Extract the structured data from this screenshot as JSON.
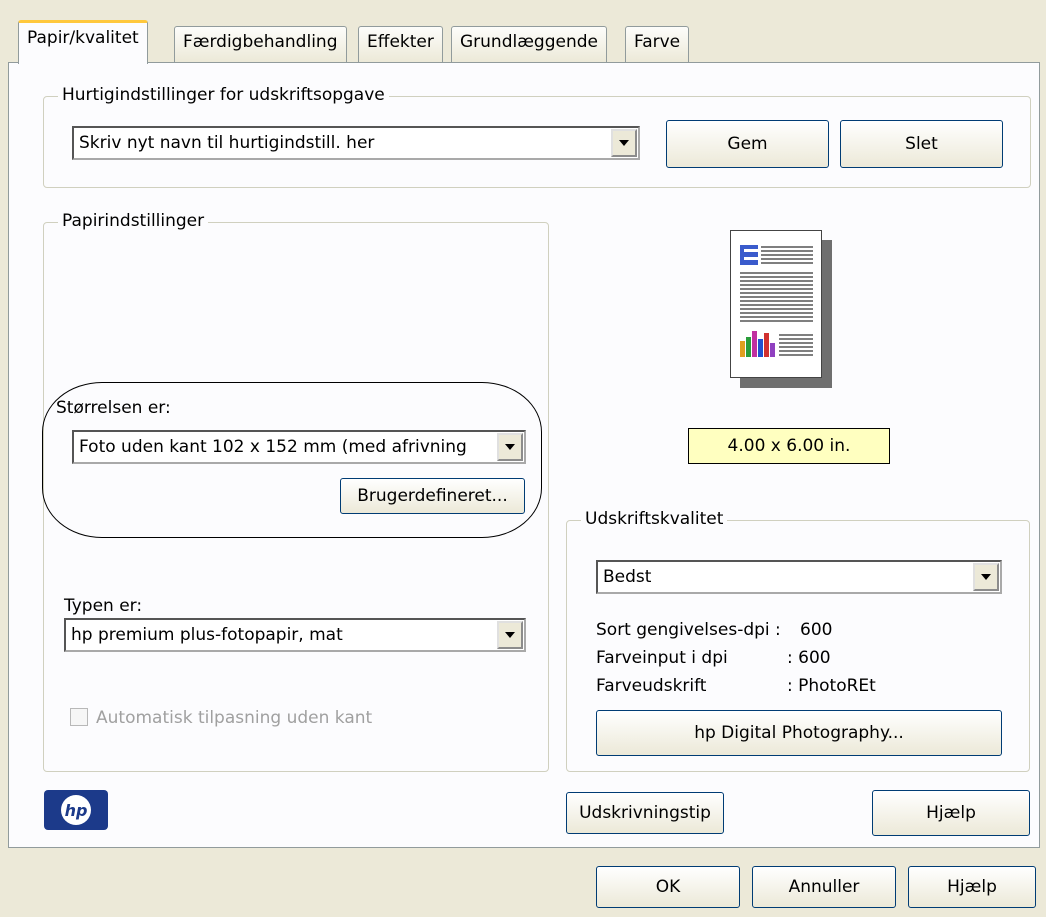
{
  "tabs": [
    {
      "label": "Papir/kvalitet"
    },
    {
      "label": "Færdigbehandling"
    },
    {
      "label": "Effekter"
    },
    {
      "label": "Grundlæggende"
    },
    {
      "label": "Farve"
    }
  ],
  "quick_settings": {
    "legend": "Hurtigindstillinger for udskriftsopgave",
    "combo_value": "Skriv nyt navn til hurtigindstill. her",
    "save_button": "Gem",
    "delete_button": "Slet"
  },
  "paper_settings": {
    "legend": "Papirindstillinger",
    "size_label": "Størrelsen er:",
    "size_value": "Foto uden kant 102 x 152 mm (med afrivning",
    "custom_button": "Brugerdefineret...",
    "type_label": "Typen er:",
    "type_value": "hp premium plus-fotopapir, mat",
    "auto_borderless_label": "Automatisk tilpasning uden kant",
    "auto_borderless_checked": false
  },
  "preview": {
    "size_readout": "4.00 x 6.00 in."
  },
  "print_quality": {
    "legend": "Udskriftskvalitet",
    "quality_value": "Bedst",
    "rows": [
      {
        "label": "Sort gengivelses-dpi :",
        "value": "600"
      },
      {
        "label": "Farveinput i dpi",
        "value": ": 600"
      },
      {
        "label": "Farveudskrift",
        "value": ": PhotoREt"
      }
    ],
    "digital_photo_button": "hp Digital Photography..."
  },
  "footer": {
    "print_tips_button": "Udskrivningstip",
    "help_button": "Hjælp",
    "logo_text": "hp"
  },
  "dialog": {
    "ok_button": "OK",
    "cancel_button": "Annuller",
    "help_button": "Hjælp"
  }
}
